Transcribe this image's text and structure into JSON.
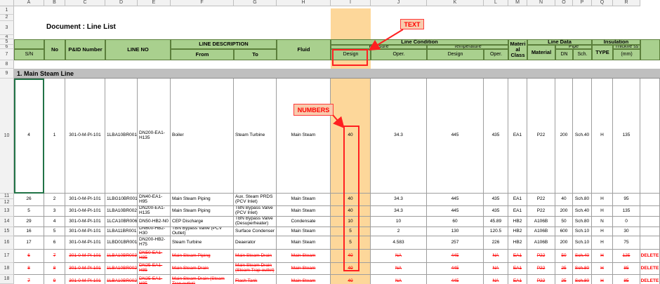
{
  "columns": [
    "A",
    "B",
    "C",
    "D",
    "E",
    "F",
    "G",
    "H",
    "I",
    "J",
    "K",
    "L",
    "M",
    "N",
    "O",
    "P",
    "Q",
    "R"
  ],
  "row_numbers": [
    "1",
    "2",
    "3",
    "4",
    "5",
    "6",
    "7",
    "8",
    "9",
    "10",
    "11",
    "12",
    "13",
    "14",
    "15",
    "16",
    "17",
    "18"
  ],
  "document_title": "Document : Line List",
  "section_title": "1. Main Steam Line",
  "headers": {
    "sn": "S/N",
    "no": "No",
    "pid": "P&ID Number",
    "line_no": "LINE NO",
    "line_desc": "LINE DESCRIPTION",
    "from": "From",
    "to": "To",
    "fluid": "Fluid",
    "line_condition": "Line Condition",
    "pressure": "Pressure",
    "temperature": "Temperature",
    "design": "Design",
    "oper": "Oper.",
    "material_class": "Materi al Class",
    "line_data": "Line Data",
    "material": "Material",
    "pipe": "Pipe",
    "dn": "DN",
    "sch": "Sch.",
    "insulation": "Insulation",
    "type": "TYPE",
    "thickness": "Thickne ss",
    "mm": "(mm)"
  },
  "annotations": {
    "text_label": "TEXT",
    "numbers_label": "NUMBERS"
  },
  "rows": [
    {
      "sn": "4",
      "no": "1",
      "pid": "301-0-M-PI-101",
      "line": "1LBA10BR001",
      "line2": "DN200-EA1-H135",
      "from": "Boiler",
      "to": "Steam Turbine",
      "fluid": "Main Steam",
      "pd": "40",
      "po": "34.3",
      "td": "445",
      "to_": "435",
      "mc": "EA1",
      "mat": "P22",
      "dn": "200",
      "sch": "Sch.40",
      "type": "H",
      "thk": "135",
      "deleted": false
    },
    {
      "sn": "26",
      "no": "2",
      "pid": "301-0-M-PI-101",
      "line": "1LBG10BR001",
      "line2": "DN40-EA1-H95",
      "from": "Main Steam Piping",
      "to": "Aux. Steam PRDS (PCV Inlet)",
      "fluid": "Main Steam",
      "pd": "40",
      "po": "34.3",
      "td": "445",
      "to_": "435",
      "mc": "EA1",
      "mat": "P22",
      "dn": "40",
      "sch": "Sch.80",
      "type": "H",
      "thk": "95",
      "deleted": false
    },
    {
      "sn": "5",
      "no": "3",
      "pid": "301-0-M-PI-101",
      "line": "1LBA10BR002",
      "line2": "DN200-EA1-H135",
      "from": "Main Steam Piping",
      "to": "TBN Bypass Valve (PCV Inlet)",
      "fluid": "Main Steam",
      "pd": "40",
      "po": "34.3",
      "td": "445",
      "to_": "435",
      "mc": "EA1",
      "mat": "P22",
      "dn": "200",
      "sch": "Sch.40",
      "type": "H",
      "thk": "135",
      "deleted": false
    },
    {
      "sn": "29",
      "no": "4",
      "pid": "301-0-M-PI-101",
      "line": "1LCA10BR006",
      "line2": "DN50-HB2-N0",
      "from": "CEP Discharge",
      "to": "TBN Bypass Valve (Desuperheater)",
      "fluid": "Condensate",
      "pd": "10",
      "po": "10",
      "td": "60",
      "to_": "45.89",
      "mc": "HB2",
      "mat": "A106B",
      "dn": "50",
      "sch": "Sch.80",
      "type": "N",
      "thk": "0",
      "deleted": false
    },
    {
      "sn": "16",
      "no": "5",
      "pid": "301-0-M-PI-101",
      "line": "1LBA11BR001",
      "line2": "DN600-HB2-H30",
      "from": "TBN Bypass Valve (PCV Outlet)",
      "to": "Surface Condenser",
      "fluid": "Main Steam",
      "pd": "5",
      "po": "2",
      "td": "130",
      "to_": "120.5",
      "mc": "HB2",
      "mat": "A106B",
      "dn": "600",
      "sch": "Sch.10",
      "type": "H",
      "thk": "30",
      "deleted": false
    },
    {
      "sn": "17",
      "no": "6",
      "pid": "301-0-M-PI-101",
      "line": "1LBD01BR001",
      "line2": "DN200-HB2-H75",
      "from": "Steam Turbine",
      "to": "Deaerator",
      "fluid": "Main Steam",
      "pd": "5",
      "po": "4.583",
      "td": "257",
      "to_": "226",
      "mc": "HB2",
      "mat": "A106B",
      "dn": "200",
      "sch": "Sch.10",
      "type": "H",
      "thk": "75",
      "deleted": false
    },
    {
      "sn": "6",
      "no": "7",
      "pid": "301-0-M-PI-101",
      "line": "1LBA10BR003",
      "line2": "DN50-EA1-H85",
      "from": "Main Steam Piping",
      "to": "Main Steam Drain",
      "fluid": "Main Steam",
      "pd": "40",
      "po": "NA",
      "td": "445",
      "to_": "NA",
      "mc": "EA1",
      "mat": "P22",
      "dn": "50",
      "sch": "Sch.40",
      "type": "H",
      "thk": "125",
      "deleted": true,
      "flag": "DELETE"
    },
    {
      "sn": "8",
      "no": "8",
      "pid": "301-0-M-PI-101",
      "line": "1LBA10BR002",
      "line2": "DN25-EA1-H85",
      "from": "Main Steam Drain",
      "to": "Main Steam Drain (Steam Trap outlet)",
      "fluid": "Main Steam",
      "pd": "40",
      "po": "NA",
      "td": "445",
      "to_": "NA",
      "mc": "EA1",
      "mat": "P22",
      "dn": "25",
      "sch": "Sch.80",
      "type": "H",
      "thk": "85",
      "deleted": true,
      "flag": "DELETE"
    },
    {
      "sn": "7",
      "no": "9",
      "pid": "301-0-M-PI-101",
      "line": "1LBA10BR002",
      "line2": "DN25-EA1-H85",
      "from": "Main Steam Drain (Steam Trap outlet)",
      "to": "Flash Tank",
      "fluid": "Main Steam",
      "pd": "40",
      "po": "NA",
      "td": "445",
      "to_": "NA",
      "mc": "EA1",
      "mat": "P22",
      "dn": "25",
      "sch": "Sch.80",
      "type": "H",
      "thk": "85",
      "deleted": true,
      "flag": "DELETE"
    }
  ],
  "colors": {
    "header_green": "#a9d08e",
    "highlight": "#fdd79a",
    "annotation_red": "#ff2020",
    "section_gray": "#bfbfbf"
  }
}
